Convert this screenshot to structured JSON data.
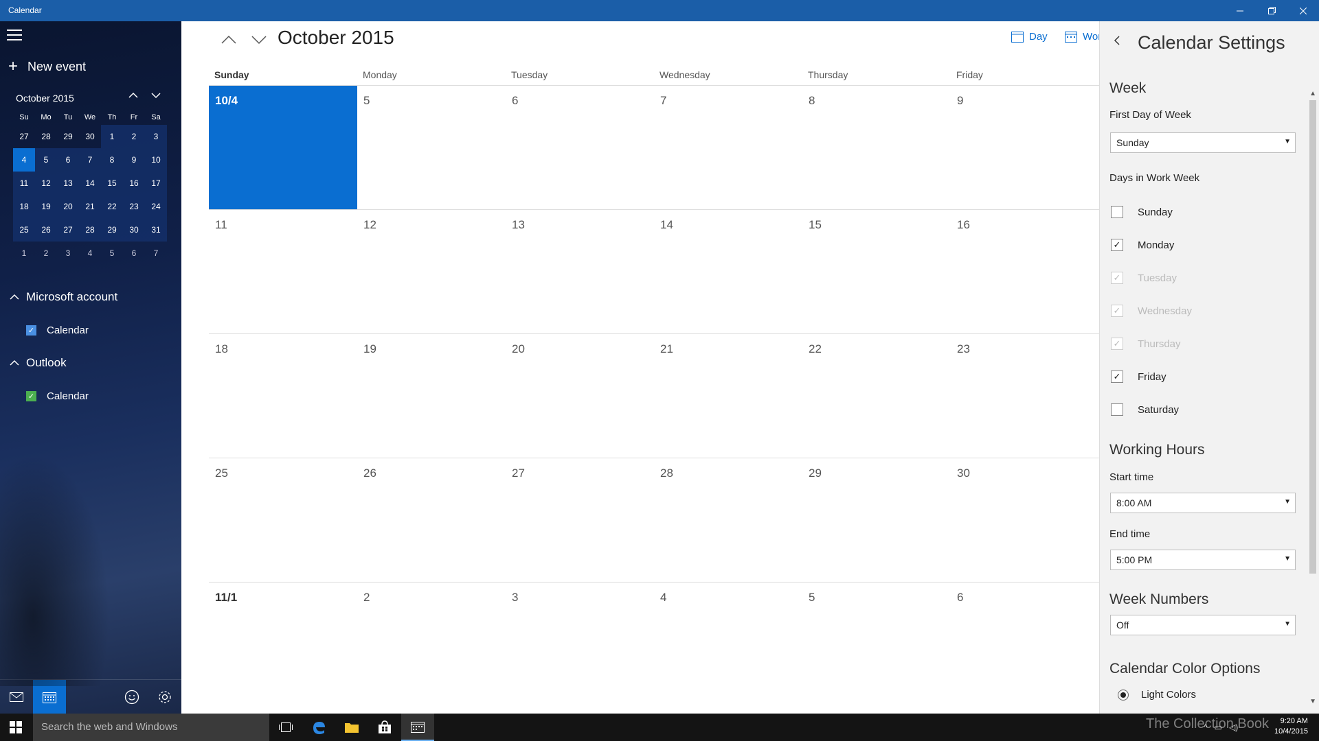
{
  "window": {
    "title": "Calendar"
  },
  "sidebar": {
    "new_event": "New event",
    "mini_calendar": {
      "title": "October 2015",
      "days_of_week": [
        "Su",
        "Mo",
        "Tu",
        "We",
        "Th",
        "Fr",
        "Sa"
      ],
      "weeks": [
        [
          "27",
          "28",
          "29",
          "30",
          "1",
          "2",
          "3"
        ],
        [
          "4",
          "5",
          "6",
          "7",
          "8",
          "9",
          "10"
        ],
        [
          "11",
          "12",
          "13",
          "14",
          "15",
          "16",
          "17"
        ],
        [
          "18",
          "19",
          "20",
          "21",
          "22",
          "23",
          "24"
        ],
        [
          "25",
          "26",
          "27",
          "28",
          "29",
          "30",
          "31"
        ],
        [
          "1",
          "2",
          "3",
          "4",
          "5",
          "6",
          "7"
        ]
      ],
      "selected": "4"
    },
    "accounts": [
      {
        "name": "Microsoft account",
        "calendar": "Calendar",
        "color": "#4a90e2"
      },
      {
        "name": "Outlook",
        "calendar": "Calendar",
        "color": "#4caf50"
      }
    ]
  },
  "main": {
    "month_title": "October 2015",
    "view_day": "Day",
    "view_work_week": "Wor",
    "days_of_week": [
      "Sunday",
      "Monday",
      "Tuesday",
      "Wednesday",
      "Thursday",
      "Friday"
    ],
    "weeks": [
      [
        "10/4",
        "5",
        "6",
        "7",
        "8",
        "9"
      ],
      [
        "11",
        "12",
        "13",
        "14",
        "15",
        "16"
      ],
      [
        "18",
        "19",
        "20",
        "21",
        "22",
        "23"
      ],
      [
        "25",
        "26",
        "27",
        "28",
        "29",
        "30"
      ],
      [
        "11/1",
        "2",
        "3",
        "4",
        "5",
        "6"
      ]
    ]
  },
  "settings": {
    "title": "Calendar Settings",
    "week_heading": "Week",
    "first_day_label": "First Day of Week",
    "first_day_value": "Sunday",
    "work_week_label": "Days in Work Week",
    "work_days": [
      {
        "label": "Sunday",
        "checked": false,
        "disabled": false
      },
      {
        "label": "Monday",
        "checked": true,
        "disabled": false
      },
      {
        "label": "Tuesday",
        "checked": true,
        "disabled": true
      },
      {
        "label": "Wednesday",
        "checked": true,
        "disabled": true
      },
      {
        "label": "Thursday",
        "checked": true,
        "disabled": true
      },
      {
        "label": "Friday",
        "checked": true,
        "disabled": false
      },
      {
        "label": "Saturday",
        "checked": false,
        "disabled": false
      }
    ],
    "working_hours_heading": "Working Hours",
    "start_time_label": "Start time",
    "start_time_value": "8:00 AM",
    "end_time_label": "End time",
    "end_time_value": "5:00 PM",
    "week_numbers_heading": "Week Numbers",
    "week_numbers_value": "Off",
    "color_options_heading": "Calendar Color Options",
    "light_colors_label": "Light Colors"
  },
  "taskbar": {
    "search_placeholder": "Search the web and Windows",
    "watermark": "The Collection Book",
    "time": "9:20 AM",
    "date": "10/4/2015"
  }
}
